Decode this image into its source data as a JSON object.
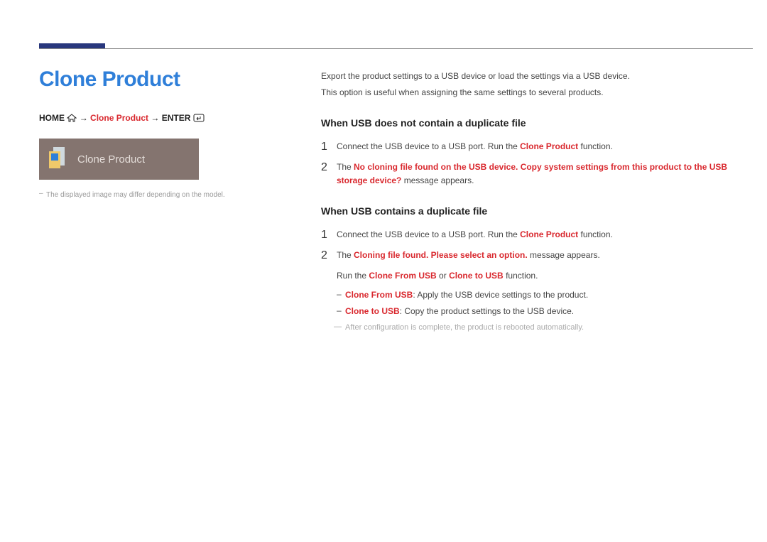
{
  "title": "Clone Product",
  "breadcrumb": {
    "home": "HOME",
    "arrow": "→",
    "item": "Clone Product",
    "enter": "ENTER"
  },
  "product_box_label": "Clone Product",
  "caption": "The displayed image may differ depending on the model.",
  "intro": {
    "p1": "Export the product settings to a USB device or load the settings via a USB device.",
    "p2": "This option is useful when assigning the same settings to several products."
  },
  "section1": {
    "heading": "When USB does not contain a duplicate file",
    "step1": {
      "num": "1",
      "pre": "Connect the USB device to a USB port. Run the ",
      "hl": "Clone Product",
      "post": " function."
    },
    "step2": {
      "num": "2",
      "pre": "The ",
      "hl": "No cloning file found on the USB device. Copy system settings from this product to the USB storage device?",
      "post": " message appears."
    }
  },
  "section2": {
    "heading": "When USB contains a duplicate file",
    "step1": {
      "num": "1",
      "pre": "Connect the USB device to a USB port. Run the ",
      "hl": "Clone Product",
      "post": " function."
    },
    "step2": {
      "num": "2",
      "pre": "The ",
      "hl": "Cloning file found. Please select an option.",
      "post": " message appears."
    },
    "run_pre": "Run the ",
    "run_h1": "Clone From USB",
    "run_mid": " or ",
    "run_h2": "Clone to USB",
    "run_post": " function.",
    "bullet1": {
      "hl": "Clone From USB",
      "txt": ": Apply the USB device settings to the product."
    },
    "bullet2": {
      "hl": "Clone to USB",
      "txt": ": Copy the product settings to the USB device."
    },
    "note": "After configuration is complete, the product is rebooted automatically."
  }
}
